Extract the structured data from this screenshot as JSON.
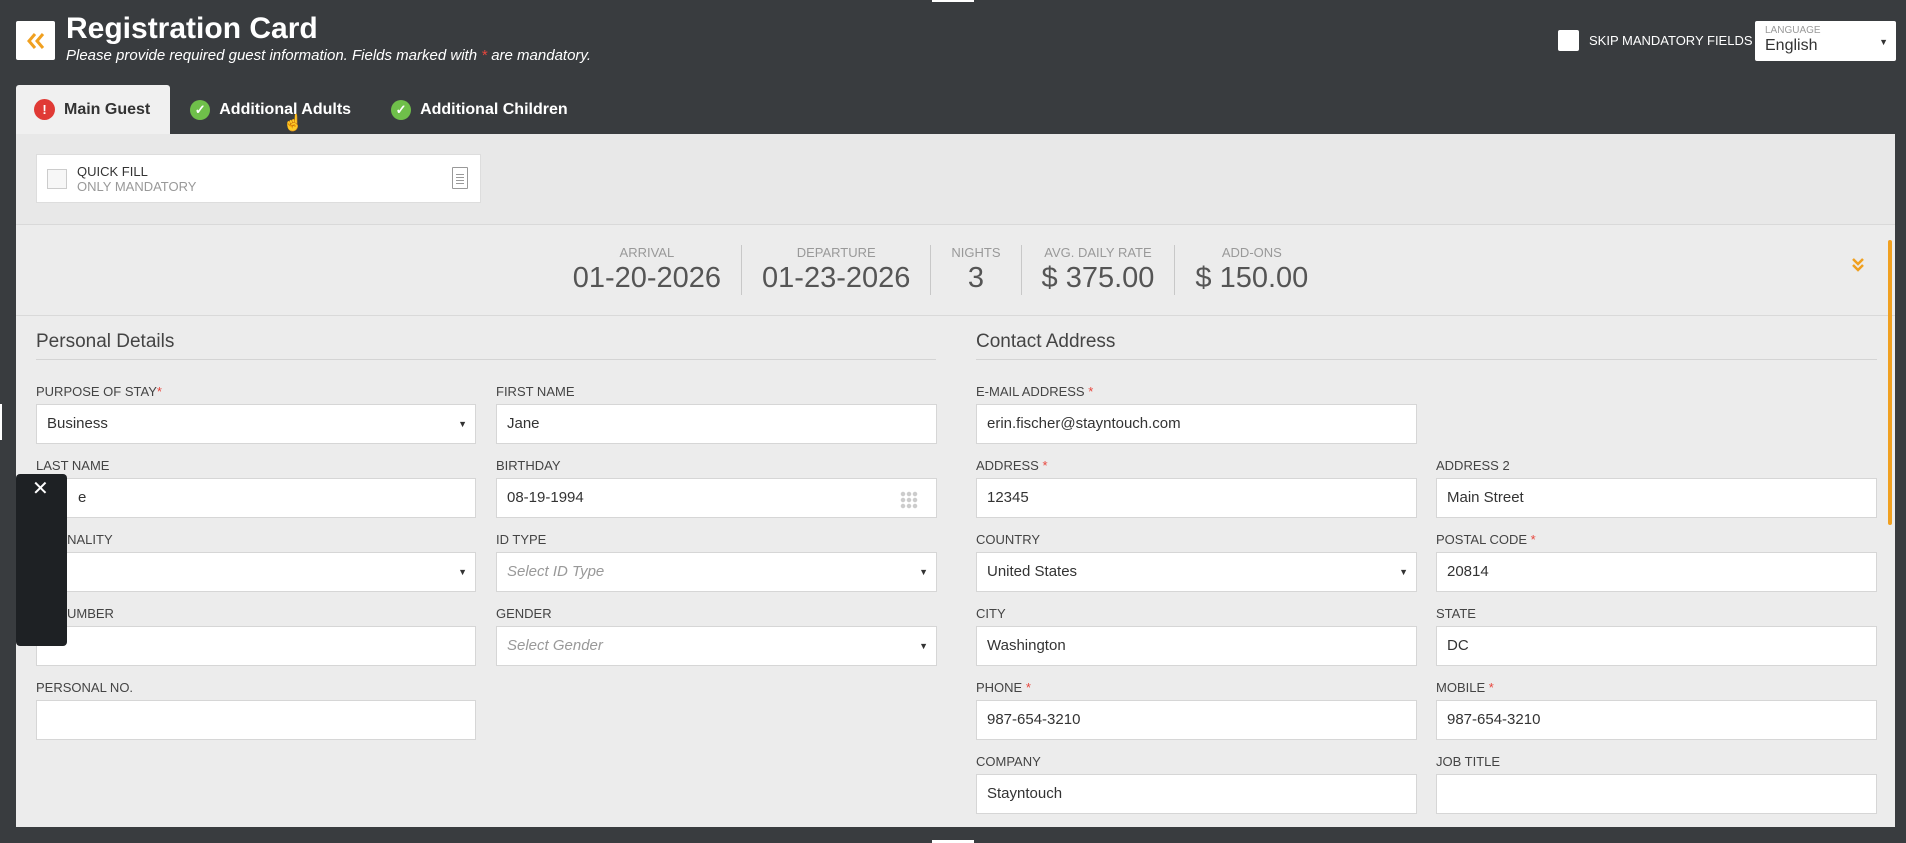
{
  "header": {
    "title": "Registration Card",
    "subtitle_before": "Please provide required guest information. Fields marked with ",
    "subtitle_marker": "*",
    "subtitle_after": " are mandatory.",
    "skip_label": "SKIP MANDATORY FIELDS",
    "language_label": "LANGUAGE",
    "language_value": "English"
  },
  "tabs": [
    {
      "label": "Main Guest",
      "status": "error"
    },
    {
      "label": "Additional Adults",
      "status": "ok"
    },
    {
      "label": "Additional Children",
      "status": "ok"
    }
  ],
  "quick_fill": {
    "title": "QUICK FILL",
    "subtitle": "ONLY MANDATORY"
  },
  "stay": {
    "arrival_label": "ARRIVAL",
    "arrival": "01-20-2026",
    "departure_label": "DEPARTURE",
    "departure": "01-23-2026",
    "nights_label": "NIGHTS",
    "nights": "3",
    "rate_label": "AVG. DAILY RATE",
    "rate": "$ 375.00",
    "addons_label": "ADD-ONS",
    "addons": "$ 150.00"
  },
  "personal": {
    "title": "Personal Details",
    "purpose_label": "PURPOSE OF STAY",
    "purpose_value": "Business",
    "first_name_label": "FIRST NAME",
    "first_name_value": "Jane",
    "last_name_label": "LAST NAME",
    "last_name_value": "e",
    "birthday_label": "BIRTHDAY",
    "birthday_value": "08-19-1994",
    "nationality_label": "ONALITY",
    "nationality_value": "",
    "id_type_label": "ID TYPE",
    "id_type_placeholder": "Select ID Type",
    "id_number_label": "UMBER",
    "id_number_value": "",
    "gender_label": "GENDER",
    "gender_placeholder": "Select Gender",
    "personal_no_label": "PERSONAL NO.",
    "personal_no_value": ""
  },
  "contact": {
    "title": "Contact Address",
    "email_label": "E-MAIL ADDRESS",
    "email_value": "erin.fischer@stayntouch.com",
    "address_label": "ADDRESS",
    "address_value": "12345",
    "address2_label": "ADDRESS 2",
    "address2_value": "Main Street",
    "country_label": "COUNTRY",
    "country_value": "United States",
    "postal_label": "POSTAL CODE",
    "postal_value": "20814",
    "city_label": "CITY",
    "city_value": "Washington",
    "state_label": "STATE",
    "state_value": "DC",
    "phone_label": "PHONE",
    "phone_value": "987-654-3210",
    "mobile_label": "MOBILE",
    "mobile_value": "987-654-3210",
    "company_label": "COMPANY",
    "company_value": "Stayntouch",
    "job_title_label": "JOB TITLE",
    "job_title_value": ""
  },
  "required_marker": "*",
  "colors": {
    "accent": "#f0a020",
    "error": "#e03a35",
    "ok": "#6fbf4a",
    "header_bg": "#393c3f"
  }
}
